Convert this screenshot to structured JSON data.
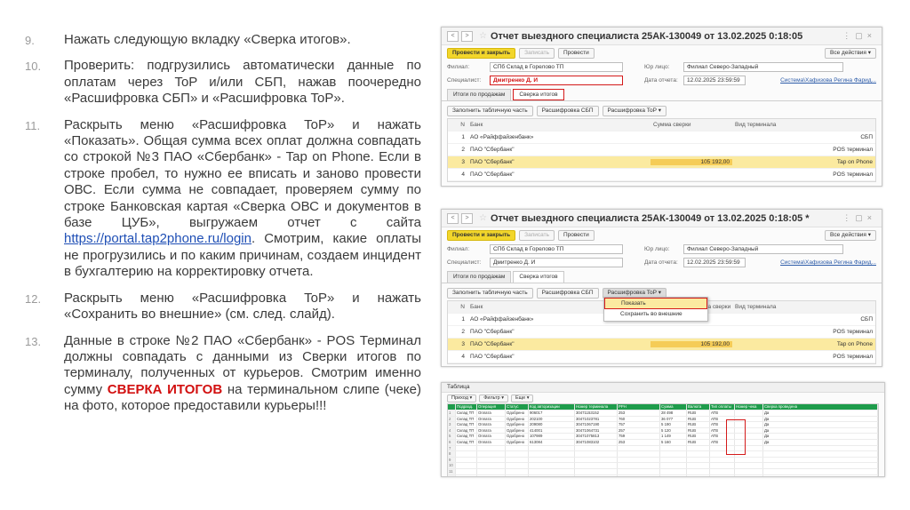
{
  "steps": [
    {
      "num": "9.",
      "text": "Нажать следующую вкладку «Сверка итогов»."
    },
    {
      "num": "10.",
      "text": "Проверить: подгрузились автоматически данные по оплатам через ToP и/или СБП, нажав поочередно «Расшифровка СБП» и «Расшифровка ToP»."
    },
    {
      "num": "11.",
      "pre": "Раскрыть меню «Расшифровка ToP» и нажать «Показать». Общая сумма всех оплат должна совпадать со строкой №3 ПАО «Сбербанк» - Tap on Phone. Если в строке пробел, то нужно ее вписать и заново провести ОВС. Если сумма не совпадает, проверяем сумму по строке Банковская картая «Сверка ОВС и документов в базе ЦУБ», выгружаем отчет с сайта ",
      "link": "https://portal.tap2phone.ru/login",
      "post": ". Смотрим, какие оплаты не прогрузились и по каким причинам, создаем инцидент в бухгалтерию на корректировку отчета."
    },
    {
      "num": "12.",
      "text": "Раскрыть меню «Расшифровка ToP» и нажать «Сохранить во внешние» (см. след. слайд)."
    },
    {
      "num": "13.",
      "pre": "Данные в строке №2 ПАО «Сбербанк» - POS Терминал должны совпадать с данными из Сверки итогов по терминалу, полученных от курьеров. Смотрим именно сумму ",
      "highlight": "СВЕРКА ИТОГОВ",
      "post": " на терминальном слипе (чеке) на фото, которое предоставили курьеры!!!"
    }
  ],
  "doc1": {
    "title": "Отчет выездного специалиста 25АК-130049 от 13.02.2025 0:18:05",
    "buttons": {
      "post_close": "Провести и закрыть",
      "save": "Записать",
      "post": "Провести",
      "more": "Все действия ▾"
    },
    "labels": {
      "branch": "Филиал:",
      "face": "Юр лицо:",
      "specialist": "Специалист:",
      "date": "Дата отчета:"
    },
    "branch_value": "СПб Склад в Горелово ТП",
    "face_value": "Филиал Северо-Западный",
    "specialist_value": "Дмитренко Д. И",
    "date_value": "12.02.2025 23:59:59",
    "responsible": "Система\\Хафизова Регина Фарид...",
    "tabs": [
      "Итоги по продажам",
      "Сверка итогов"
    ],
    "actions": [
      "Заполнить табличную часть",
      "Расшифровка СБП",
      "Расшифровка ToP ▾"
    ],
    "columns": [
      "N",
      "Банк",
      "Сумма сверки",
      "Вид терминала"
    ],
    "rows": [
      {
        "n": "1",
        "bank": "АО «Райффайзенбанк»",
        "sum": "",
        "type": "СБП"
      },
      {
        "n": "2",
        "bank": "ПАО \"Сбербанк\"",
        "sum": "",
        "type": "POS терминал"
      },
      {
        "n": "3",
        "bank": "ПАО \"Сбербанк\"",
        "sum": "105 192,00",
        "type": "Tap on Phone"
      },
      {
        "n": "4",
        "bank": "ПАО \"Сбербанк\"",
        "sum": "",
        "type": "POS терминал"
      }
    ]
  },
  "doc2": {
    "title": "Отчет выездного специалиста 25АК-130049 от 13.02.2025 0:18:05 *",
    "menu": [
      "Показать",
      "Сохранить во внешние"
    ],
    "columns": [
      "N",
      "Банк",
      "ма сверки",
      "Вид терминала"
    ]
  },
  "sheet": {
    "title": "Таблица",
    "tools": [
      "Приход ▾",
      "Фильтр ▾",
      "Еще ▾"
    ],
    "header": [
      "",
      "Подразд.",
      "Операция",
      "Статус",
      "Код авторизации",
      "Номер терминала",
      "РРН",
      "Сумма",
      "Валюта",
      "Тип оплаты",
      "Номер чека",
      "Сверка проведена"
    ],
    "rows": [
      [
        "1",
        "Склад ТП",
        "Оплата",
        "Одобрено",
        "906017",
        "30471153152",
        "253",
        "28 498",
        "RUB",
        "ATB",
        "",
        "Да"
      ],
      [
        "2",
        "Склад ТП",
        "Оплата",
        "Одобрено",
        "202100",
        "30471023781",
        "760",
        "36 077",
        "RUB",
        "ATB",
        "",
        "Да"
      ],
      [
        "3",
        "Склад ТП",
        "Оплата",
        "Одобрено",
        "209080",
        "30471067190",
        "757",
        "5 190",
        "RUB",
        "ATB",
        "",
        "Да"
      ],
      [
        "4",
        "Склад ТП",
        "Оплата",
        "Одобрено",
        "414001",
        "30471064731",
        "257",
        "5 120",
        "RUB",
        "ATB",
        "",
        "Да"
      ],
      [
        "5",
        "Склад ТП",
        "Оплата",
        "Одобрено",
        "107989",
        "30471075813",
        "759",
        "1 149",
        "RUB",
        "ATB",
        "",
        "Да"
      ],
      [
        "6",
        "Склад ТП",
        "Оплата",
        "Одобрено",
        "613084",
        "30471083102",
        "253",
        "5 160",
        "RUB",
        "ATB",
        "",
        "Да"
      ],
      [
        "7",
        "",
        "",
        "",
        "",
        "",
        "",
        "",
        "",
        "",
        "",
        ""
      ],
      [
        "8",
        "",
        "",
        "",
        "",
        "",
        "",
        "",
        "",
        "",
        "",
        ""
      ],
      [
        "9",
        "",
        "",
        "",
        "",
        "",
        "",
        "",
        "",
        "",
        "",
        ""
      ],
      [
        "10",
        "",
        "",
        "",
        "",
        "",
        "",
        "",
        "",
        "",
        "",
        ""
      ],
      [
        "11",
        "",
        "",
        "",
        "",
        "",
        "",
        "",
        "",
        "",
        "",
        ""
      ],
      [
        "12",
        "",
        "",
        "",
        "",
        "",
        "",
        "",
        "",
        "",
        "",
        ""
      ]
    ]
  }
}
